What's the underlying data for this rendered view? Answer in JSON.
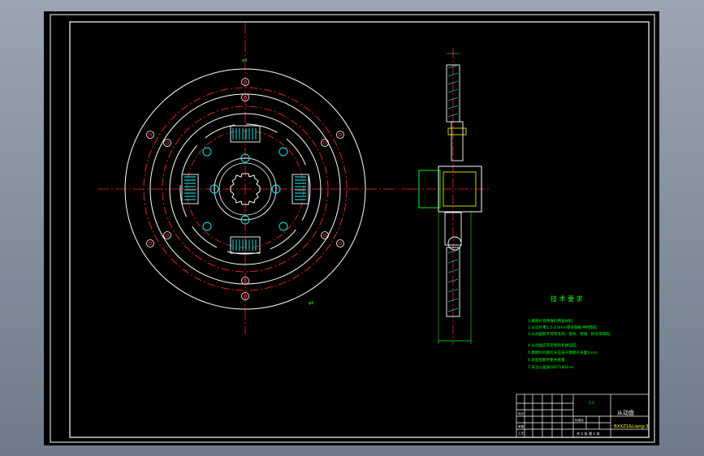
{
  "drawing": {
    "title": "从动盘",
    "tech_heading": "技 术 要 求",
    "tech_notes": [
      "1.摩擦片有特殊的用途材料;",
      "2.从动片用1.5-2.0mm厚的钢板冲制而成;",
      "3.从动盘毂不得有毛刺、裂纹、锈蚀、损伤等缺陷;",
      "4.从动盘应有足够的机械强度;",
      "5.摩擦片的铆钉头应低于摩擦片表面1mm;",
      "6.装配后静平衡失衡量",
      "7.未注公差按GB/T1804-m"
    ],
    "drawing_code": "BXXZ1&Liang-3",
    "scale_label": "比例",
    "scale_value": "1:1",
    "sheet_label": "共 1 张 第 1 张",
    "table_small": [
      "设计",
      "审核",
      "工艺",
      "标准化"
    ],
    "small_marks": [
      "φ4",
      "φ6"
    ]
  },
  "colors": {
    "background": "#000000",
    "frame": "#ffffff",
    "centerline": "#ff2020",
    "outline": "#ffffff",
    "hatch": "#00ffff",
    "accent_green": "#00ff00",
    "accent_yellow": "#ffff00",
    "text_green": "#00ff00"
  }
}
